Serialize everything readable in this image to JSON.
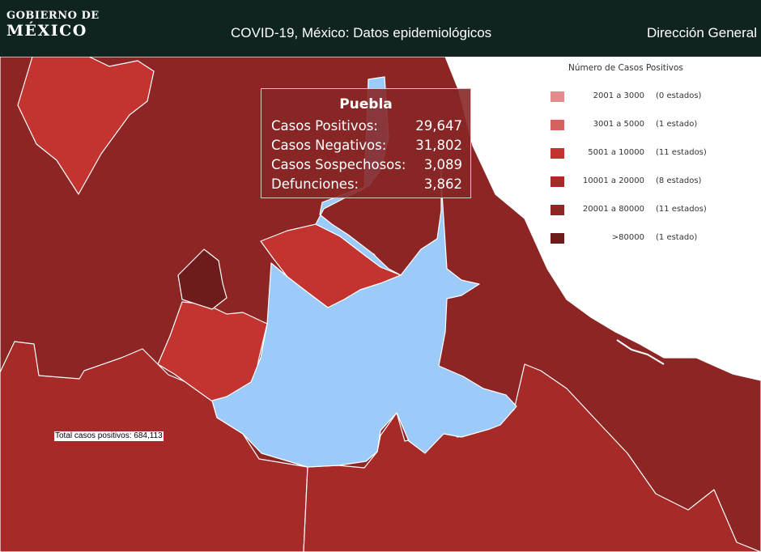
{
  "header": {
    "logo_line1": "GOBIERNO DE",
    "logo_line2": "MÉXICO",
    "app_title": "COVID-19, México: Datos epidemiológicos",
    "nav_link": "Dirección General"
  },
  "legend": {
    "title": "Número de Casos Positivos",
    "items": [
      {
        "range": "2001 a   3000",
        "count": "(0 estados)",
        "color": "#e08c8c"
      },
      {
        "range": "3001 a   5000",
        "count": "(1 estado)",
        "color": "#d4625f"
      },
      {
        "range": "5001 a  10000",
        "count": "(11 estados)",
        "color": "#c33330"
      },
      {
        "range": "10001 a  20000",
        "count": "(8 estados)",
        "color": "#a62a28"
      },
      {
        "range": "20001 a  80000",
        "count": "(11 estados)",
        "color": "#8c2524"
      },
      {
        "range": ">80000",
        "count": "(1 estado)",
        "color": "#6e1b1b"
      }
    ]
  },
  "tooltip": {
    "state": "Puebla",
    "rows": [
      {
        "label": "Casos Positivos:",
        "value": "29,647"
      },
      {
        "label": "Casos Negativos:",
        "value": "31,802"
      },
      {
        "label": "Casos Sospechosos:",
        "value": "3,089"
      },
      {
        "label": "Defunciones:",
        "value": "3,862"
      }
    ]
  },
  "total_label": "Total casos positivos: 684,113",
  "colors": {
    "header_bg": "#10241f",
    "selected_state": "#9ccbfa",
    "tooltip_bg": "#872727",
    "border": "#ffffff"
  }
}
